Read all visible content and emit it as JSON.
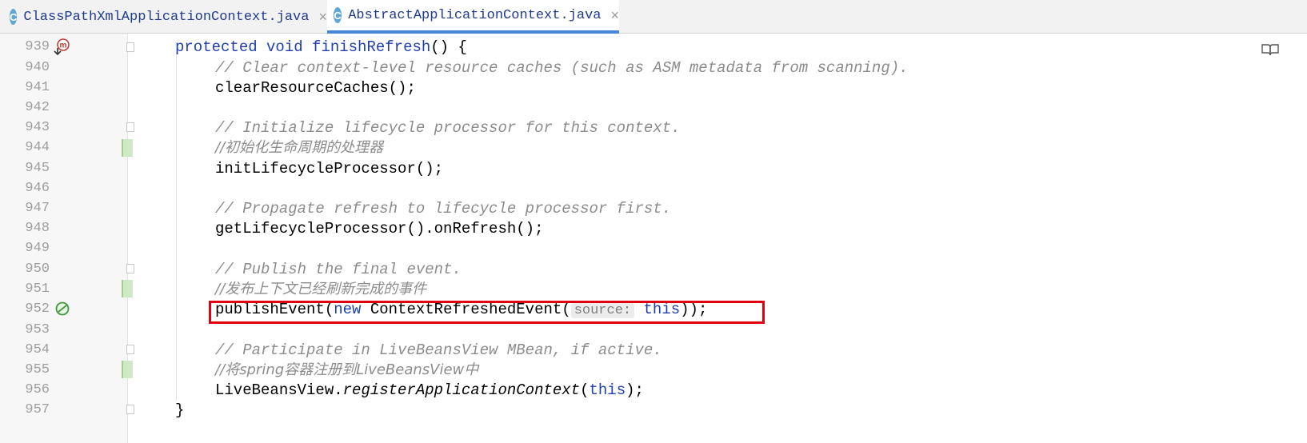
{
  "tabs": [
    {
      "icon": "class-c-icon",
      "label": "ClassPathXmlApplicationContext.java",
      "active": false
    },
    {
      "icon": "class-c-icon",
      "label": "AbstractApplicationContext.java",
      "active": true
    }
  ],
  "icons": {
    "class": "C",
    "close": "×"
  },
  "colors": {
    "keyword": "#1f3fb0",
    "comment": "#8c8c8c",
    "highlight_box": "#e0000f",
    "active_tab_underline": "#4a86d6"
  },
  "lines": [
    {
      "number": "939"
    },
    {
      "number": "940"
    },
    {
      "number": "941"
    },
    {
      "number": "942"
    },
    {
      "number": "943"
    },
    {
      "number": "944"
    },
    {
      "number": "945"
    },
    {
      "number": "946"
    },
    {
      "number": "947"
    },
    {
      "number": "948"
    },
    {
      "number": "949"
    },
    {
      "number": "950"
    },
    {
      "number": "951"
    },
    {
      "number": "952"
    },
    {
      "number": "953"
    },
    {
      "number": "954"
    },
    {
      "number": "955"
    },
    {
      "number": "956"
    },
    {
      "number": "957"
    }
  ],
  "code": {
    "l939": {
      "kw1": "protected",
      "kw2": "void",
      "fn": "finishRefresh",
      "rest": "() {"
    },
    "l940": "// Clear context-level resource caches (such as ASM metadata from scanning).",
    "l941": "clearResourceCaches();",
    "l943": "// Initialize lifecycle processor for this context.",
    "l944": "//初始化生命周期的处理器",
    "l945": "initLifecycleProcessor();",
    "l947": "// Propagate refresh to lifecycle processor first.",
    "l948": "getLifecycleProcessor().onRefresh();",
    "l950": "// Publish the final event.",
    "l951": "//发布上下文已经刷新完成的事件",
    "l952": {
      "call": "publishEvent(",
      "kw_new": "new",
      "cls": " ContextRefreshedEvent(",
      "hint": "source:",
      "kw_this": "this",
      "end": "));"
    },
    "l954": "// Participate in LiveBeansView MBean, if active.",
    "l955": "//将spring容器注册到LiveBeansView中",
    "l956": {
      "cls": "LiveBeansView.",
      "method": "registerApplicationContext",
      "open": "(",
      "kw_this": "this",
      "end": ");"
    },
    "l957": "}"
  }
}
